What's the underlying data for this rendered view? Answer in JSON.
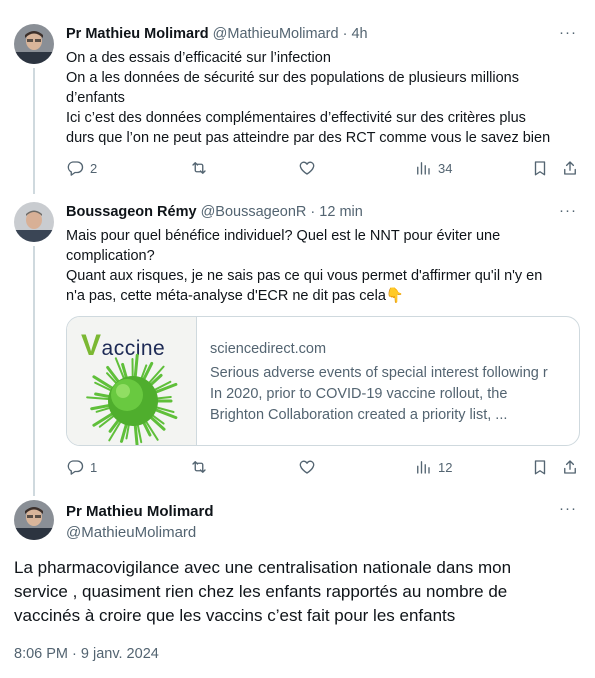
{
  "tweet1": {
    "name": "Pr Mathieu Molimard",
    "handle": "@MathieuMolimard",
    "sep": " · ",
    "time": "4h",
    "lines": [
      "On a des essais d’efficacité sur l’infection",
      "On a les données de sécurité sur des populations de plusieurs millions",
      "d’enfants",
      "Ici c’est des données complémentaires d’effectivité sur des critères plus",
      "durs que l’on ne peut pas atteindre par des RCT comme  vous le savez bien"
    ],
    "replies": "2",
    "retweets": "",
    "likes": "",
    "views": "34"
  },
  "tweet2": {
    "name": "Boussageon Rémy",
    "handle": "@BoussageonR",
    "sep": " · ",
    "time": "12 min",
    "lines": [
      "Mais pour quel bénéfice individuel? Quel est le NNT pour éviter une",
      "complication?",
      "Quant aux risques, je ne sais pas ce qui vous permet d'affirmer qu'il n'y en",
      "n'a pas, cette méta-analyse d'ECR ne dit pas cela👇"
    ],
    "card": {
      "brand_v": "V",
      "brand_rest": "accine",
      "domain": "sciencedirect.com",
      "title": "Serious adverse events of special interest following r",
      "desc_lines": [
        "In 2020, prior to COVID-19 vaccine rollout, the",
        "Brighton Collaboration created a priority list, ..."
      ]
    },
    "replies": "1",
    "retweets": "",
    "likes": "",
    "views": "12"
  },
  "main_tweet": {
    "name": "Pr Mathieu Molimard",
    "handle": "@MathieuMolimard",
    "lines": [
      "La pharmacovigilance avec une centralisation nationale dans mon",
      "service , quasiment rien chez les enfants rapportés au nombre de",
      "vaccinés à croire que les vaccins c’est fait pour les enfants"
    ],
    "timestamp": "8:06 PM · 9 janv. 2024"
  },
  "more_label": "···",
  "icons": [
    "reply-icon",
    "retweet-icon",
    "like-icon",
    "views-icon",
    "bookmark-icon",
    "share-icon",
    "more-icon"
  ],
  "colors": {
    "text": "#0f1419",
    "secondary": "#536471",
    "border": "#cfd9de",
    "thread_line": "#cfd9de",
    "vaccine_green": "#7bb833"
  }
}
